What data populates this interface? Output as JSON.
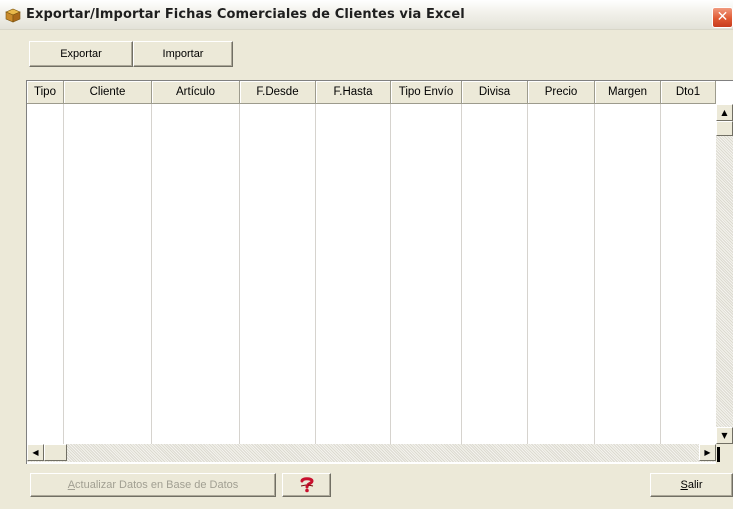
{
  "window": {
    "title": "Exportar/Importar Fichas Comerciales de Clientes via Excel",
    "close_glyph": "✕"
  },
  "toolbar": {
    "export_label": "Exportar",
    "import_label": "Importar"
  },
  "grid": {
    "columns": [
      "Tipo",
      "Cliente",
      "Artículo",
      "F.Desde",
      "F.Hasta",
      "Tipo Envío",
      "Divisa",
      "Precio",
      "Margen",
      "Dto1"
    ],
    "rows": []
  },
  "footer": {
    "update_label_accel": "A",
    "update_label_rest": "ctualizar Datos en Base de Datos",
    "help_icon": "help-icon",
    "exit_label_accel": "S",
    "exit_label_rest": "alir"
  },
  "colors": {
    "window_bg": "#ece9d8",
    "close_red": "#e05a33",
    "help_red": "#c8102e"
  }
}
